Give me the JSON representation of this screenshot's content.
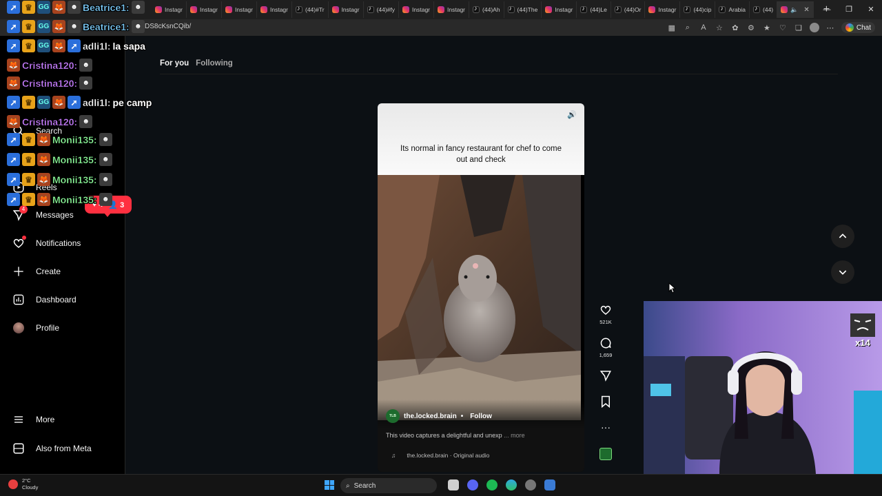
{
  "browser": {
    "tabs": [
      {
        "label": "Instagr",
        "type": "ig"
      },
      {
        "label": "Instagr",
        "type": "ig"
      },
      {
        "label": "Instagr",
        "type": "ig"
      },
      {
        "label": "Instagr",
        "type": "ig"
      },
      {
        "label": "(44)#Tr",
        "type": "tt"
      },
      {
        "label": "Instagr",
        "type": "ig"
      },
      {
        "label": "(44)#fy",
        "type": "tt"
      },
      {
        "label": "Instagr",
        "type": "ig"
      },
      {
        "label": "Instagr",
        "type": "ig"
      },
      {
        "label": "(44)Ah",
        "type": "tt"
      },
      {
        "label": "(44)The",
        "type": "tt"
      },
      {
        "label": "Instagr",
        "type": "ig"
      },
      {
        "label": "(44)Le",
        "type": "tt"
      },
      {
        "label": "(44)Or",
        "type": "tt"
      },
      {
        "label": "Instagr",
        "type": "ig"
      },
      {
        "label": "(44)cip",
        "type": "tt"
      },
      {
        "label": "Arabia",
        "type": "tt"
      },
      {
        "label": "(44)",
        "type": "tt"
      }
    ],
    "url": "DS8cKsnCQib/",
    "chat_label": "Chat"
  },
  "instagram": {
    "nav": {
      "search": "Search",
      "reels": "Reels",
      "messages": "Messages",
      "messages_badge": "4",
      "notifications": "Notifications",
      "create": "Create",
      "dashboard": "Dashboard",
      "profile": "Profile",
      "more": "More",
      "also_from_meta": "Also from Meta"
    },
    "notif_pill": {
      "likes": "4",
      "follows": "3"
    },
    "feed_tabs": {
      "for_you": "For you",
      "following": "Following"
    },
    "reel": {
      "caption": "Its normal in fancy restaurant for chef to come out and check",
      "author": "the.locked.brain",
      "separator": "•",
      "follow": "Follow",
      "description": "This video captures a delightful and unexp",
      "more": "... more",
      "audio": "the.locked.brain · Original audio",
      "likes": "521K",
      "comments": "1,659"
    }
  },
  "twitch_chat": [
    {
      "user": "Beatrice1:",
      "color": "#7fd0ff",
      "badges": [
        "pin",
        "crown",
        "gg",
        "fox",
        "face"
      ],
      "msg": ""
    },
    {
      "user": "Beatrice1:",
      "color": "#7fd0ff",
      "badges": [
        "pin",
        "crown",
        "gg",
        "fox",
        "face"
      ],
      "msg": ""
    },
    {
      "user": "adli1l:",
      "color": "#ffffff",
      "badges": [
        "pin",
        "crown",
        "gg",
        "fox",
        "pin"
      ],
      "msg": "la sapa"
    },
    {
      "user": "Cristina120:",
      "color": "#c77dff",
      "badges": [
        "fox"
      ],
      "msg": ""
    },
    {
      "user": "Cristina120:",
      "color": "#c77dff",
      "badges": [
        "fox"
      ],
      "msg": ""
    },
    {
      "user": "adli1l:",
      "color": "#ffffff",
      "badges": [
        "pin",
        "crown",
        "gg",
        "fox",
        "pin"
      ],
      "msg": "pe camp"
    },
    {
      "user": "Cristina120:",
      "color": "#c77dff",
      "badges": [
        "fox"
      ],
      "msg": ""
    },
    {
      "user": "Monii135:",
      "color": "#8dfc9b",
      "badges": [
        "pin",
        "crown",
        "fox"
      ],
      "msg": ""
    },
    {
      "user": "Monii135:",
      "color": "#8dfc9b",
      "badges": [
        "pin",
        "crown",
        "fox"
      ],
      "msg": ""
    },
    {
      "user": "Monii135:",
      "color": "#8dfc9b",
      "badges": [
        "pin",
        "crown",
        "fox"
      ],
      "msg": ""
    },
    {
      "user": "Monii135:",
      "color": "#8dfc9b",
      "badges": [
        "pin",
        "crown",
        "fox"
      ],
      "msg": ""
    }
  ],
  "webcam": {
    "badge": "x14"
  },
  "taskbar": {
    "temp": "2°C",
    "weather": "Cloudy",
    "search": "Search"
  },
  "colors": {
    "accent_red": "#ff3040",
    "background": "#0c1014"
  }
}
